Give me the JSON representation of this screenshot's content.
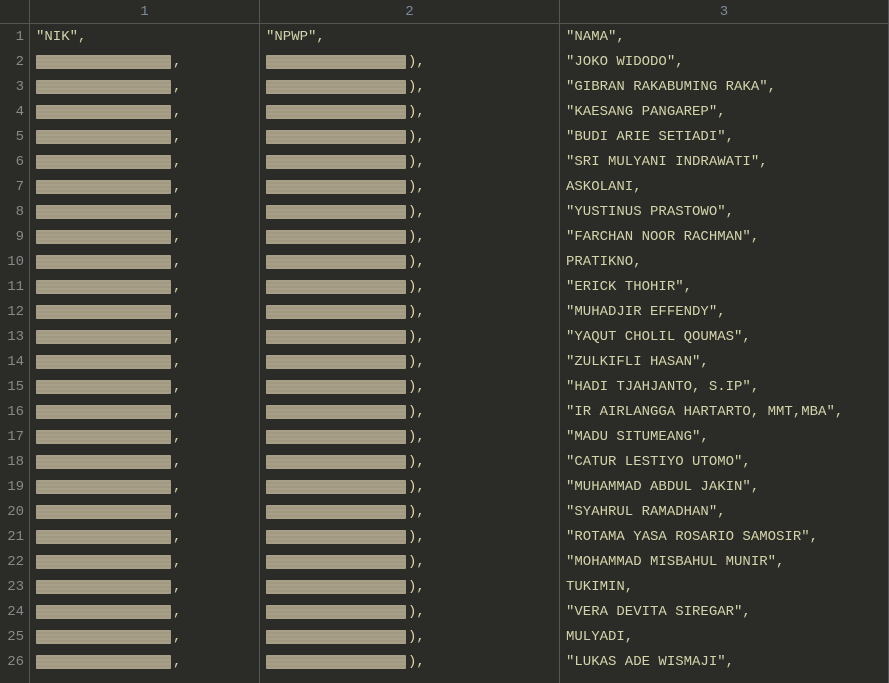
{
  "columns": {
    "num": [
      "1",
      "2",
      "3"
    ],
    "col1_header": "NIK",
    "col2_header": "NPWP",
    "col3_header": "NAMA"
  },
  "rows": [
    {
      "n": "1",
      "c1": "\"NIK\",",
      "c2": "\"NPWP\",",
      "c3": "\"NAMA\",",
      "redacted": false
    },
    {
      "n": "2",
      "c3": "\"JOKO WIDODO\",",
      "redacted": true
    },
    {
      "n": "3",
      "c3": "\"GIBRAN RAKABUMING RAKA\",",
      "redacted": true
    },
    {
      "n": "4",
      "c3": "\"KAESANG PANGAREP\",",
      "redacted": true
    },
    {
      "n": "5",
      "c3": "\"BUDI ARIE SETIADI\",",
      "redacted": true
    },
    {
      "n": "6",
      "c3": "\"SRI MULYANI INDRAWATI\",",
      "redacted": true
    },
    {
      "n": "7",
      "c3": "ASKOLANI,",
      "redacted": true
    },
    {
      "n": "8",
      "c3": "\"YUSTINUS PRASTOWO\",",
      "redacted": true
    },
    {
      "n": "9",
      "c3": "\"FARCHAN NOOR RACHMAN\",",
      "redacted": true
    },
    {
      "n": "10",
      "c3": "PRATIKNO,",
      "redacted": true
    },
    {
      "n": "11",
      "c3": "\"ERICK THOHIR\",",
      "redacted": true
    },
    {
      "n": "12",
      "c3": "\"MUHADJIR EFFENDY\",",
      "redacted": true
    },
    {
      "n": "13",
      "c3": "\"YAQUT CHOLIL QOUMAS\",",
      "redacted": true
    },
    {
      "n": "14",
      "c3": "\"ZULKIFLI HASAN\",",
      "redacted": true
    },
    {
      "n": "15",
      "c3": "\"HADI TJAHJANTO, S.IP\",",
      "redacted": true
    },
    {
      "n": "16",
      "c3": "\"IR AIRLANGGA HARTARTO, MMT,MBA\",",
      "redacted": true
    },
    {
      "n": "17",
      "c3": "\"MADU SITUMEANG\",",
      "redacted": true
    },
    {
      "n": "18",
      "c3": "\"CATUR LESTIYO UTOMO\",",
      "redacted": true
    },
    {
      "n": "19",
      "c3": "\"MUHAMMAD ABDUL JAKIN\",",
      "redacted": true
    },
    {
      "n": "20",
      "c3": "\"SYAHRUL RAMADHAN\",",
      "redacted": true
    },
    {
      "n": "21",
      "c3": "\"ROTAMA YASA ROSARIO SAMOSIR\",",
      "redacted": true
    },
    {
      "n": "22",
      "c3": "\"MOHAMMAD MISBAHUL MUNIR\",",
      "redacted": true
    },
    {
      "n": "23",
      "c3": "TUKIMIN,",
      "redacted": true
    },
    {
      "n": "24",
      "c3": "\"VERA DEVITA SIREGAR\",",
      "redacted": true
    },
    {
      "n": "25",
      "c3": "MULYADI,",
      "redacted": true
    },
    {
      "n": "26",
      "c3": "\"LUKAS ADE WISMAJI\",",
      "redacted": true
    }
  ],
  "redact_trail_c1": ",",
  "redact_trail_c2": "),"
}
